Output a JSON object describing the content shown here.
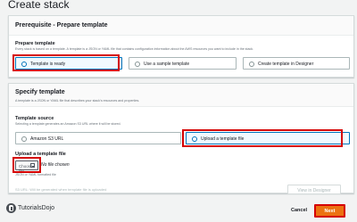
{
  "page": {
    "title": "Create stack"
  },
  "prerequisite": {
    "heading": "Prerequisite - Prepare template",
    "label": "Prepare template",
    "description": "Every stack is based on a template. A template is a JSON or YAML file that contains configuration information about the AWS resources you want to include in the stack.",
    "options": [
      {
        "label": "Template is ready",
        "selected": true
      },
      {
        "label": "Use a sample template",
        "selected": false
      },
      {
        "label": "Create template in Designer",
        "selected": false
      }
    ]
  },
  "specify": {
    "heading": "Specify template",
    "subheading": "A template is a JSON or YAML file that describes your stack's resources and properties.",
    "source_label": "Template source",
    "source_description": "Selecting a template generates an Amazon S3 URL where it will be stored.",
    "options": [
      {
        "label": "Amazon S3 URL",
        "selected": false
      },
      {
        "label": "Upload a template file",
        "selected": true
      }
    ],
    "upload_label": "Upload a template file",
    "choose_file_label": "Choose file",
    "no_file_text": "No file chosen",
    "upload_hint": "JSON or YAML formatted file",
    "s3_url_label": "S3 URL:",
    "s3_url_value": "Will be generated when template file is uploaded",
    "view_designer_label": "View in Designer"
  },
  "footer": {
    "brand": "TutorialsDojo",
    "cancel_label": "Cancel",
    "next_label": "Next"
  },
  "colors": {
    "accent": "#0073bb",
    "primary_button": "#ec7211",
    "annotation": "#d50000"
  }
}
